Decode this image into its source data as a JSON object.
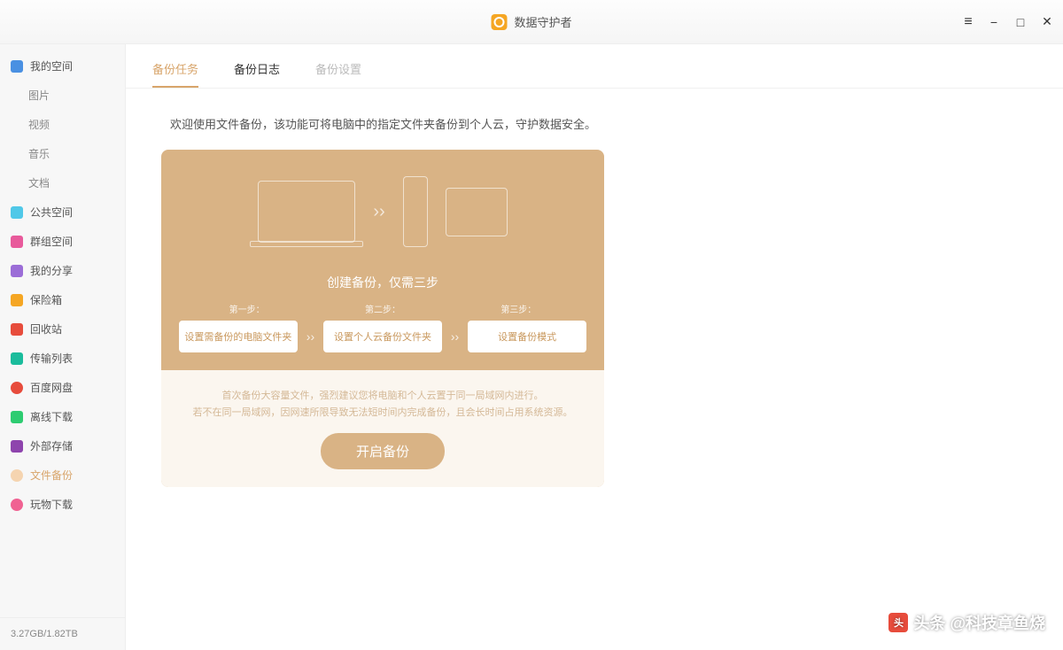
{
  "app": {
    "title": "数据守护者"
  },
  "sidebar": {
    "items": [
      {
        "label": "我的空间",
        "icon": "ic-blue"
      },
      {
        "label": "图片",
        "sub": true
      },
      {
        "label": "视频",
        "sub": true
      },
      {
        "label": "音乐",
        "sub": true
      },
      {
        "label": "文档",
        "sub": true
      },
      {
        "label": "公共空间",
        "icon": "ic-cyan"
      },
      {
        "label": "群组空间",
        "icon": "ic-pink"
      },
      {
        "label": "我的分享",
        "icon": "ic-purple"
      },
      {
        "label": "保险箱",
        "icon": "ic-orange"
      },
      {
        "label": "回收站",
        "icon": "ic-red"
      },
      {
        "label": "传输列表",
        "icon": "ic-teal"
      },
      {
        "label": "百度网盘",
        "icon": "ic-bd"
      },
      {
        "label": "离线下载",
        "icon": "ic-green"
      },
      {
        "label": "外部存储",
        "icon": "ic-violet"
      },
      {
        "label": "文件备份",
        "icon": "ic-cloud",
        "active": true
      },
      {
        "label": "玩物下载",
        "icon": "ic-play"
      }
    ],
    "storage": "3.27GB/1.82TB"
  },
  "tabs": [
    {
      "label": "备份任务",
      "state": "active"
    },
    {
      "label": "备份日志",
      "state": ""
    },
    {
      "label": "备份设置",
      "state": "disabled"
    }
  ],
  "welcome": "欢迎使用文件备份，该功能可将电脑中的指定文件夹备份到个人云，守护数据安全。",
  "steps": {
    "title": "创建备份，仅需三步",
    "labels": [
      "第一步：",
      "第二步：",
      "第三步："
    ],
    "boxes": [
      "设置需备份的电脑文件夹",
      "设置个人云备份文件夹",
      "设置备份模式"
    ]
  },
  "tips": [
    "首次备份大容量文件，强烈建议您将电脑和个人云置于同一局域网内进行。",
    "若不在同一局域网，因网速所限导致无法短时间内完成备份，且会长时间占用系统资源。"
  ],
  "start_button": "开启备份",
  "watermark": "头条 @科技章鱼烧"
}
